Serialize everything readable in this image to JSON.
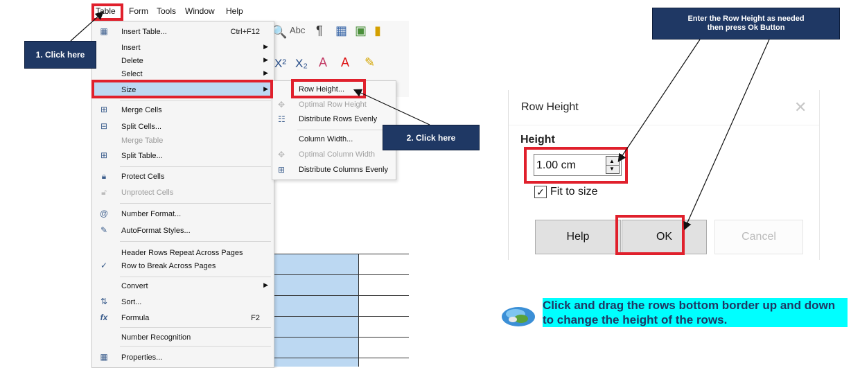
{
  "menubar": {
    "items": [
      "Table",
      "Form",
      "Tools",
      "Window",
      "Help"
    ]
  },
  "table_menu": {
    "items": [
      {
        "icon": "insert-table-icon",
        "label": "Insert Table...",
        "shortcut": "Ctrl+F12"
      },
      {
        "label": "Insert",
        "submenu": true
      },
      {
        "label": "Delete",
        "submenu": true
      },
      {
        "label": "Select",
        "submenu": true
      },
      {
        "label": "Size",
        "submenu": true,
        "selected": true
      },
      {
        "icon": "merge-cells-icon",
        "label": "Merge Cells"
      },
      {
        "icon": "split-cells-icon",
        "label": "Split Cells..."
      },
      {
        "label": "Merge Table",
        "disabled": true
      },
      {
        "icon": "split-table-icon",
        "label": "Split Table..."
      },
      {
        "icon": "protect-cells-icon",
        "label": "Protect Cells"
      },
      {
        "icon": "unprotect-cells-icon",
        "label": "Unprotect Cells",
        "disabled": true
      },
      {
        "icon": "number-format-icon",
        "label": "Number Format..."
      },
      {
        "icon": "autoformat-icon",
        "label": "AutoFormat Styles..."
      },
      {
        "label": "Header Rows Repeat Across Pages"
      },
      {
        "icon": "check-icon",
        "label": "Row to Break Across Pages"
      },
      {
        "label": "Convert",
        "submenu": true
      },
      {
        "icon": "sort-icon",
        "label": "Sort..."
      },
      {
        "icon": "formula-icon",
        "label": "Formula",
        "shortcut": "F2"
      },
      {
        "label": "Number Recognition"
      },
      {
        "icon": "properties-icon",
        "label": "Properties..."
      }
    ]
  },
  "size_submenu": {
    "items": [
      {
        "label": "Row Height..."
      },
      {
        "label": "Optimal Row Height",
        "disabled": true
      },
      {
        "label": "Distribute Rows Evenly"
      },
      {
        "label": "Column Width..."
      },
      {
        "label": "Optimal Column Width",
        "disabled": true
      },
      {
        "label": "Distribute Columns Evenly"
      }
    ]
  },
  "callouts": {
    "step1": "1. Click here",
    "step2": "2. Click here",
    "dialog_hint": "Enter the Row Height as needed then press Ok Button"
  },
  "dialog": {
    "title": "Row Height",
    "height_label": "Height",
    "height_value": "1.00 cm",
    "fit_label": "Fit to size",
    "fit_checked": true,
    "help_label": "Help",
    "ok_label": "OK",
    "cancel_label": "Cancel"
  },
  "tip": {
    "text": "Click and drag the rows bottom border up and down to change the height of the rows."
  },
  "colors": {
    "callout_bg": "#1f3864",
    "highlight": "#e0202c",
    "tip_bg": "#00ffff",
    "selection": "#bcd8f2"
  }
}
